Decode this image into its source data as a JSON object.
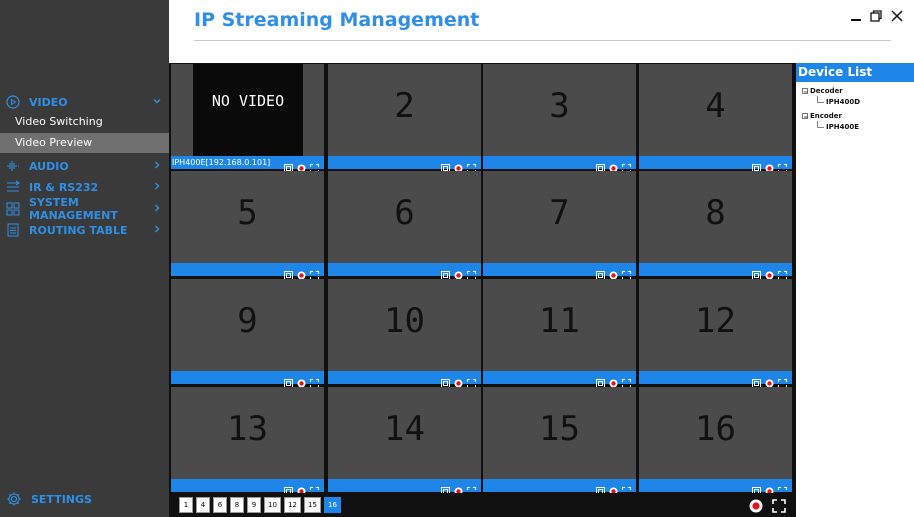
{
  "app": {
    "title": "IP Streaming Management"
  },
  "window": {
    "minimize_icon": "minimize-icon",
    "restore_icon": "restore-icon",
    "close_icon": "close-icon"
  },
  "sidebar": {
    "groups": [
      {
        "label": "VIDEO",
        "icon": "play-circle-icon"
      },
      {
        "label": "AUDIO",
        "icon": "audio-wave-icon"
      },
      {
        "label": "IR & RS232",
        "icon": "list-icon"
      },
      {
        "label": "SYSTEM MANAGEMENT",
        "icon": "grid-icon"
      },
      {
        "label": "ROUTING TABLE",
        "icon": "table-icon"
      }
    ],
    "video_sub": [
      {
        "label": "Video Switching",
        "active": false
      },
      {
        "label": "Video Preview",
        "active": true
      }
    ],
    "settings": {
      "label": "SETTINGS",
      "icon": "gear-icon"
    }
  },
  "grid": {
    "cells": [
      {
        "number": "",
        "no_video": "NO VIDEO",
        "label": "IPH400E[192.168.0.101]"
      },
      {
        "number": "2",
        "label": ""
      },
      {
        "number": "3",
        "label": ""
      },
      {
        "number": "4",
        "label": ""
      },
      {
        "number": "5",
        "label": ""
      },
      {
        "number": "6",
        "label": ""
      },
      {
        "number": "7",
        "label": ""
      },
      {
        "number": "8",
        "label": ""
      },
      {
        "number": "9",
        "label": ""
      },
      {
        "number": "10",
        "label": ""
      },
      {
        "number": "11",
        "label": ""
      },
      {
        "number": "12",
        "label": ""
      },
      {
        "number": "13",
        "label": ""
      },
      {
        "number": "14",
        "label": ""
      },
      {
        "number": "15",
        "label": ""
      },
      {
        "number": "16",
        "label": ""
      }
    ],
    "cell_controls": [
      "snapshot-icon",
      "record-icon",
      "fullscreen-icon"
    ]
  },
  "pager": {
    "layouts": [
      "1",
      "4",
      "6",
      "8",
      "9",
      "10",
      "12",
      "15",
      "16"
    ],
    "active": "16",
    "record_icon": "record-all-icon",
    "fullscreen_icon": "fullscreen-all-icon"
  },
  "device_list": {
    "title": "Device List",
    "groups": [
      {
        "label": "Decoder",
        "devices": [
          "IPH400D"
        ]
      },
      {
        "label": "Encoder",
        "devices": [
          "IPH400E"
        ]
      }
    ]
  },
  "colors": {
    "accent": "#1e86e8",
    "sidebar_bg": "#3a3a3a",
    "cell_bg": "#4b4b4b",
    "grid_bg": "#101010"
  }
}
